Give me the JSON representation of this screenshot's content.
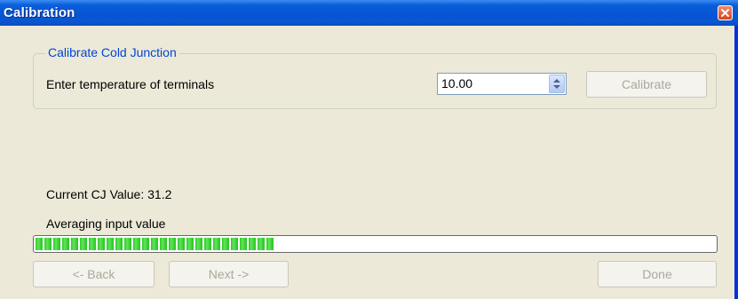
{
  "window": {
    "title": "Calibration"
  },
  "group": {
    "legend": "Calibrate Cold Junction",
    "prompt": "Enter temperature of terminals",
    "temperature_value": "10.00",
    "calibrate_label": "Calibrate"
  },
  "status": {
    "current_cj": "Current CJ Value: 31.2",
    "progress_label": "Averaging input value",
    "progress_fraction": 0.35
  },
  "footer": {
    "back_label": "<- Back",
    "next_label": "Next ->",
    "done_label": "Done"
  },
  "colors": {
    "titlebar": "#0754d6",
    "progress_green": "#2fc829",
    "legend_blue": "#0046d5"
  }
}
